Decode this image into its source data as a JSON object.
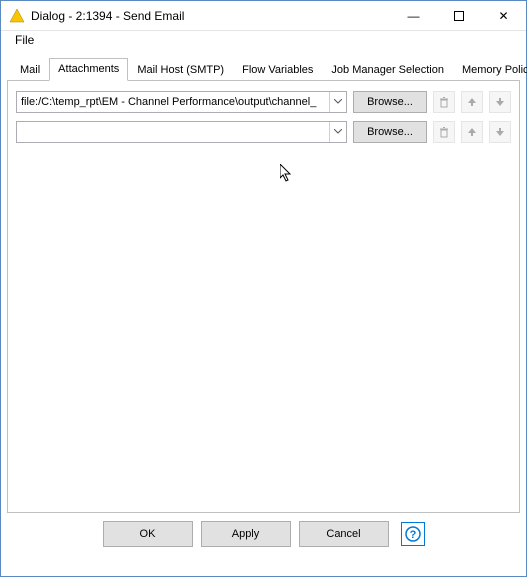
{
  "window": {
    "title": "Dialog - 2:1394 - Send Email"
  },
  "menu": {
    "file": "File"
  },
  "tabs": {
    "mail": "Mail",
    "attachments": "Attachments",
    "mailhost": "Mail Host (SMTP)",
    "flowvars": "Flow Variables",
    "jobmgr": "Job Manager Selection",
    "mempolicy": "Memory Policy"
  },
  "rows": [
    {
      "path": "file:/C:\\temp_rpt\\EM - Channel Performance\\output\\channel_",
      "browse": "Browse..."
    },
    {
      "path": "",
      "browse": "Browse..."
    }
  ],
  "buttons": {
    "ok": "OK",
    "apply": "Apply",
    "cancel": "Cancel"
  },
  "icons": {
    "minimize": "—",
    "maximize": "▢",
    "close": "✕",
    "dropdown": "▾",
    "help": "?"
  }
}
